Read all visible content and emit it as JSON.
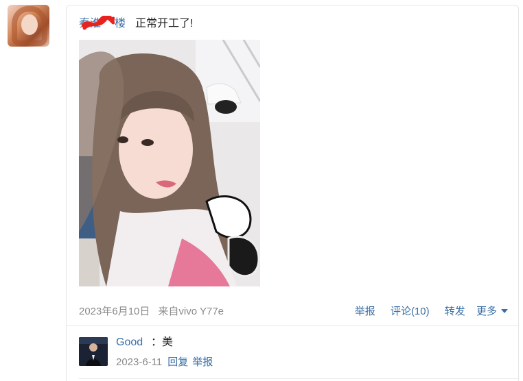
{
  "post": {
    "author": "秦淮",
    "author_tail": "楼",
    "text": "正常开工了!",
    "date": "2023年6月10日",
    "source": "来自vivo Y77e",
    "actions": {
      "report": "举报",
      "comment": "评论(10)",
      "forward": "转发",
      "more": "更多"
    }
  },
  "comment": {
    "author": "Good",
    "text": "：美",
    "date": "2023-6-11",
    "reply": "回复",
    "report": "举报"
  },
  "icons": {
    "more_caret": "chevron-down-icon",
    "redaction": "red-scribble"
  },
  "colors": {
    "link": "#3a6ea5",
    "meta": "#8a8a8a",
    "redaction": "#e8231f"
  }
}
